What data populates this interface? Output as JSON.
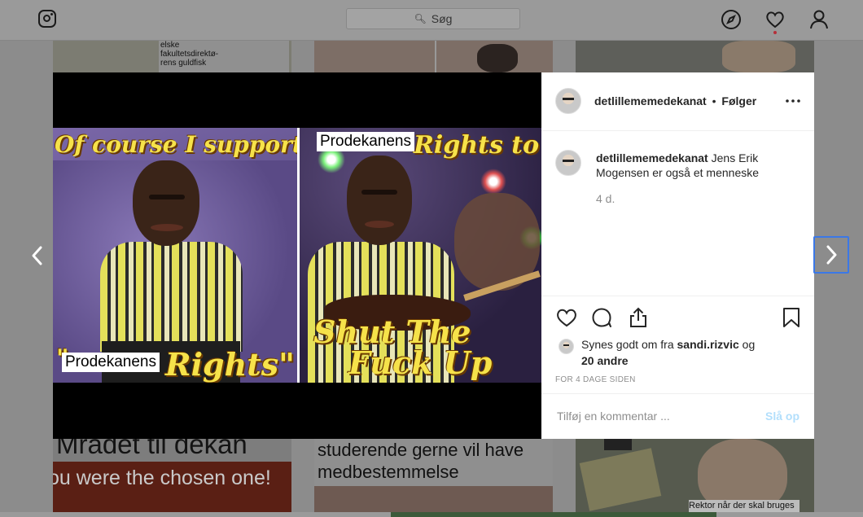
{
  "nav": {
    "logo_icon": "instagram-icon",
    "search_placeholder": "Søg",
    "icons": [
      "compass-icon",
      "heart-icon",
      "profile-icon"
    ],
    "notification_dot_color": "#ed4956"
  },
  "background_tiles": {
    "tile1_caption": "elske fakultetsdirektø- rens guldfisk",
    "tile4_caption": "Mrådet til dekan",
    "tile4_subcaption": "ou were the chosen one!",
    "tile5_caption": "studerende gerne vil have medbestemmelse",
    "tile6_caption": "Rektor når der skal bruges"
  },
  "post": {
    "image": {
      "left_top_text": "Of course I support",
      "left_box_label": "Prodekanens",
      "left_bottom_text": "Rights\"",
      "left_bottom_quote": "\"",
      "right_box_label": "Prodekanens",
      "right_top_text": "Rights to",
      "right_bottom_line1": "Shut The",
      "right_bottom_line2": "Fuck Up"
    },
    "header": {
      "username": "detlillememedekanat",
      "dot": "•",
      "follow_state": "Følger",
      "more_icon": "more-horizontal-icon"
    },
    "caption": {
      "username": "detlillememedekanat",
      "text": "Jens Erik Mogensen er også et menneske",
      "age": "4 d."
    },
    "actions": {
      "like_icon": "heart-outline-icon",
      "comment_icon": "comment-icon",
      "share_icon": "share-icon",
      "save_icon": "bookmark-icon"
    },
    "likes": {
      "prefix": "Synes godt om fra",
      "user": "sandi.rizvic",
      "joiner": "og",
      "others": "20 andre"
    },
    "timestamp": "FOR 4 DAGE SIDEN",
    "comment_box": {
      "placeholder": "Tilføj en kommentar ...",
      "post_button": "Slå op",
      "post_button_color": "#b2dffc"
    }
  },
  "arrows": {
    "prev_icon": "chevron-left-icon",
    "next_icon": "chevron-right-icon"
  }
}
